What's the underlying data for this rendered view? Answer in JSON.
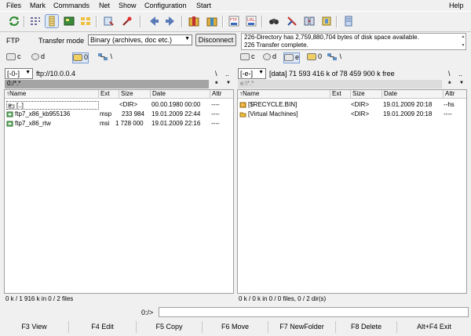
{
  "menu": [
    "Files",
    "Mark",
    "Commands",
    "Net",
    "Show",
    "Configuration",
    "Start"
  ],
  "menu_help": "Help",
  "ftp": {
    "label": "FTP",
    "transfer_label": "Transfer mode",
    "transfer_value": "Binary (archives, doc etc.)",
    "disconnect": "Disconnect",
    "log": [
      "226-Directory has 2,759,880,704 bytes of disk space available.",
      "226 Transfer complete."
    ]
  },
  "left": {
    "drives": [
      "c",
      "d",
      "0"
    ],
    "drive_combo": "[-0-]",
    "path": "ftp://10.0.0.4",
    "nav": [
      "\\",
      ".."
    ],
    "current": "0:/*.*",
    "star": "*",
    "headers": [
      "↑Name",
      "Ext",
      "Size",
      "Date",
      "Attr"
    ],
    "rows": [
      {
        "name": "[..]",
        "ext": "",
        "size": "<DIR>",
        "date": "00.00.1980 00:00",
        "attr": "----"
      },
      {
        "name": "ftp7_x86_kb955136",
        "ext": "msp",
        "size": "233 984",
        "date": "19.01.2009 22:44",
        "attr": "----"
      },
      {
        "name": "ftp7_x86_rtw",
        "ext": "msi",
        "size": "1 728 000",
        "date": "19.01.2009 22:16",
        "attr": "----"
      }
    ],
    "status": "0 k / 1 916 k in 0 / 2 files"
  },
  "right": {
    "drives": [
      "c",
      "d",
      "e",
      "0"
    ],
    "drive_combo": "[-e-]",
    "path": "[data]  71 593 416 k of 78 459 900 k free",
    "nav": [
      "\\",
      ".."
    ],
    "current": "e:\\*.*",
    "star": "*",
    "headers": [
      "↑Name",
      "Ext",
      "Size",
      "Date",
      "Attr"
    ],
    "rows": [
      {
        "name": "[$RECYCLE.BIN]",
        "ext": "",
        "size": "<DIR>",
        "date": "19.01.2009 20:18",
        "attr": "--hs"
      },
      {
        "name": "[Virtual Machines]",
        "ext": "",
        "size": "<DIR>",
        "date": "19.01.2009 20:18",
        "attr": "----"
      }
    ],
    "status": "0 k / 0 k in 0 / 0 files, 0 / 2 dir(s)"
  },
  "cmdline": {
    "prompt": "0:/>"
  },
  "fkeys": [
    "F3 View",
    "F4 Edit",
    "F5 Copy",
    "F6 Move",
    "F7 NewFolder",
    "F8 Delete",
    "Alt+F4 Exit"
  ],
  "colors": {
    "folder": "#f0c040",
    "file": "#3a9a3a",
    "recycle": "#e0a020"
  }
}
